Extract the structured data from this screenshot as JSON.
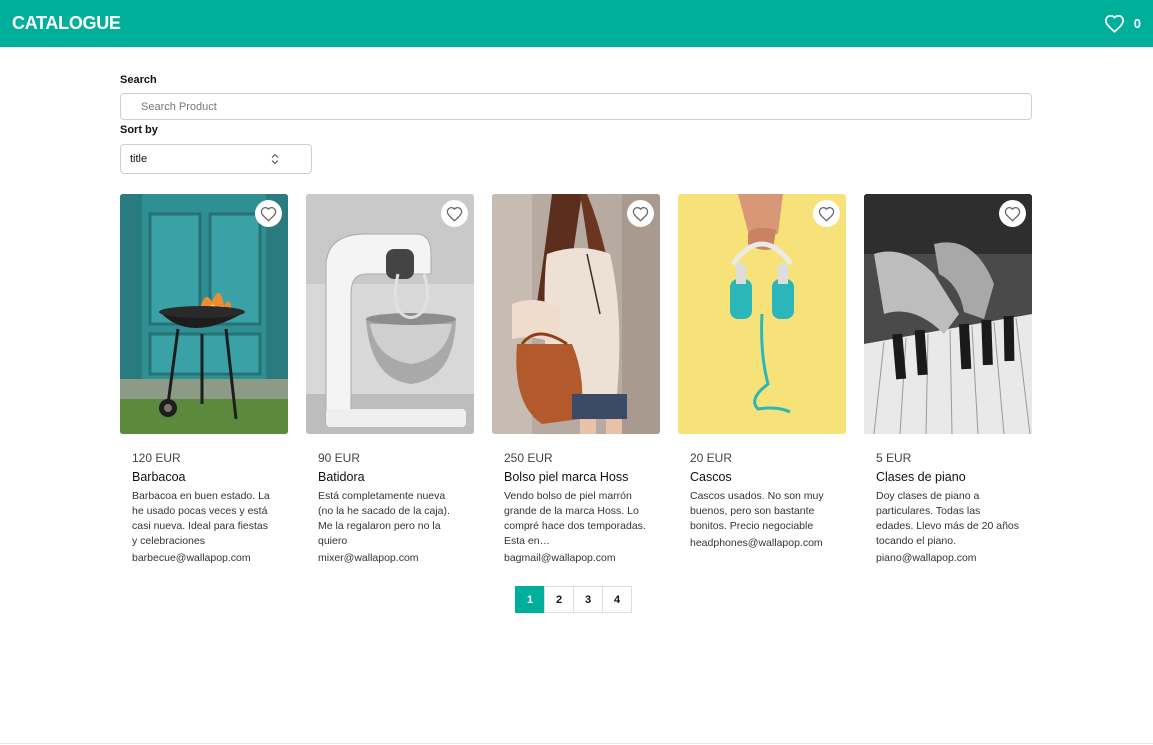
{
  "header": {
    "brand": "CATALOGUE",
    "favorites_count": "0"
  },
  "search": {
    "label": "Search",
    "placeholder": "Search Product",
    "value": ""
  },
  "sort": {
    "label": "Sort by",
    "selected": "title"
  },
  "products": [
    {
      "price": "120 EUR",
      "title": "Barbacoa",
      "description": "Barbacoa en buen estado. La he usado pocas veces y está casi nueva. Ideal para fiestas y celebraciones",
      "email": "barbecue@wallapop.com",
      "image_desc": "barbecue grill in front of teal wooden door"
    },
    {
      "price": "90 EUR",
      "title": "Batidora",
      "description": "Está completamente nueva (no la he sacado de la caja). Me la regalaron pero no la quiero",
      "email": "mixer@wallapop.com",
      "image_desc": "white stand mixer with steel bowl"
    },
    {
      "price": "250 EUR",
      "title": "Bolso piel marca Hoss",
      "description": "Vendo bolso de piel marrón grande de la marca Hoss. Lo compré hace dos temporadas. Esta en…",
      "email": "bagmail@wallapop.com",
      "image_desc": "woman carrying brown leather bag"
    },
    {
      "price": "20 EUR",
      "title": "Cascos",
      "description": "Cascos usados. No son muy buenos, pero son bastante bonitos. Precio negociable",
      "email": "headphones@wallapop.com",
      "image_desc": "turquoise headphones on yellow background"
    },
    {
      "price": "5 EUR",
      "title": "Clases de piano",
      "description": "Doy clases de piano a particulares. Todas las edades. Llevo más de 20 años tocando el piano.",
      "email": "piano@wallapop.com",
      "image_desc": "hands playing piano keys"
    }
  ],
  "pagination": {
    "pages": [
      "1",
      "2",
      "3",
      "4"
    ],
    "current": "1"
  },
  "colors": {
    "brand": "#00AF9A",
    "white": "#ffffff"
  },
  "icons": {
    "header_favorites": "heart-outline-icon",
    "card_favorite": "heart-outline-icon",
    "sort_chevrons": "chevron-up-down-icon"
  }
}
